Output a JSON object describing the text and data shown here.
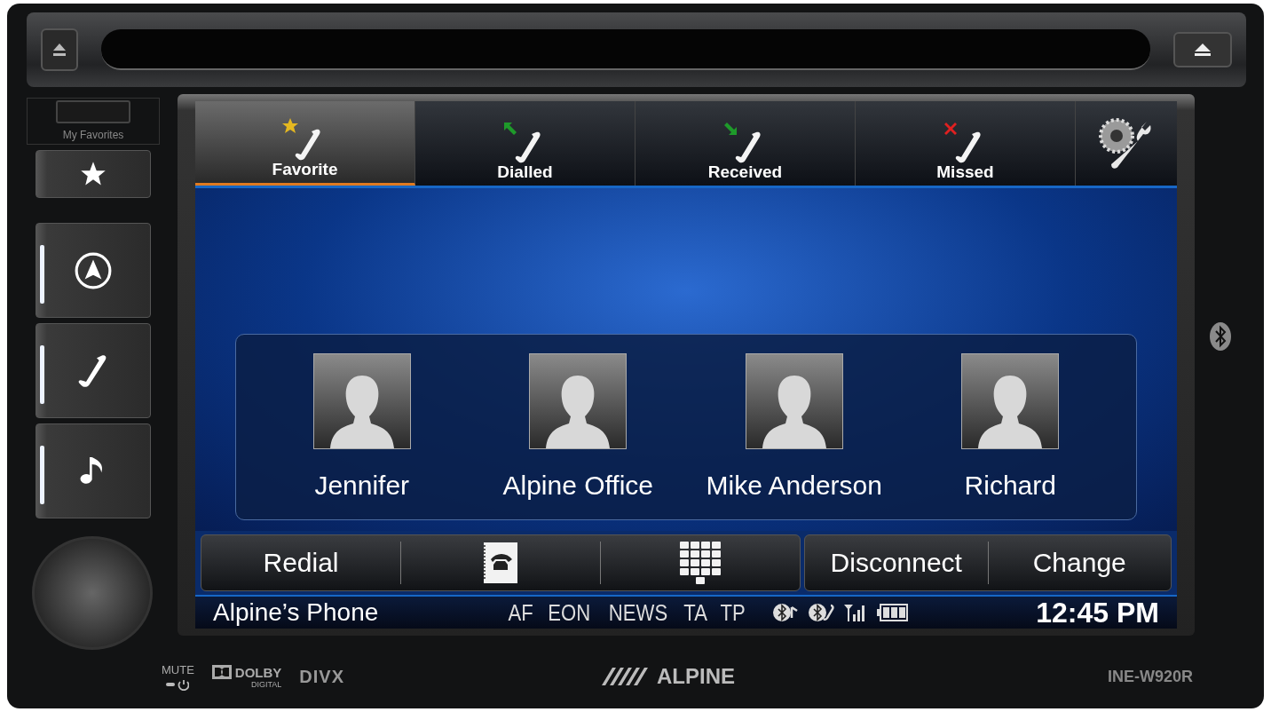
{
  "device": {
    "favorites_label": "My Favorites",
    "hard_buttons": [
      {
        "kind": "star"
      },
      {
        "kind": "navigation"
      },
      {
        "kind": "phone"
      },
      {
        "kind": "music"
      }
    ],
    "mute_label": "MUTE",
    "dolby": "DOLBY",
    "dolby_sub": "DIGITAL",
    "divx": "DIVX",
    "brand": "ALPINE",
    "model": "INE-W920R"
  },
  "tabs": [
    {
      "kind": "favorite",
      "label": "Favorite",
      "selected": true
    },
    {
      "kind": "dialled",
      "label": "Dialled",
      "selected": false
    },
    {
      "kind": "received",
      "label": "Received",
      "selected": false
    },
    {
      "kind": "missed",
      "label": "Missed",
      "selected": false
    },
    {
      "kind": "settings",
      "selected": false
    }
  ],
  "contacts": [
    {
      "name": "Jennifer"
    },
    {
      "name": "Alpine Office"
    },
    {
      "name": "Mike Anderson"
    },
    {
      "name": "Richard"
    }
  ],
  "button_groups": [
    [
      {
        "kind": "text",
        "label": "Redial"
      },
      {
        "kind": "phonebook"
      },
      {
        "kind": "keypad"
      }
    ],
    [
      {
        "kind": "text",
        "label": "Disconnect"
      },
      {
        "kind": "text",
        "label": "Change"
      }
    ]
  ],
  "status_bar": {
    "device_name": "Alpine’s Phone",
    "indicators": [
      "AF",
      "EON",
      "NEWS",
      "TA",
      "TP"
    ],
    "time": "12:45 PM"
  }
}
